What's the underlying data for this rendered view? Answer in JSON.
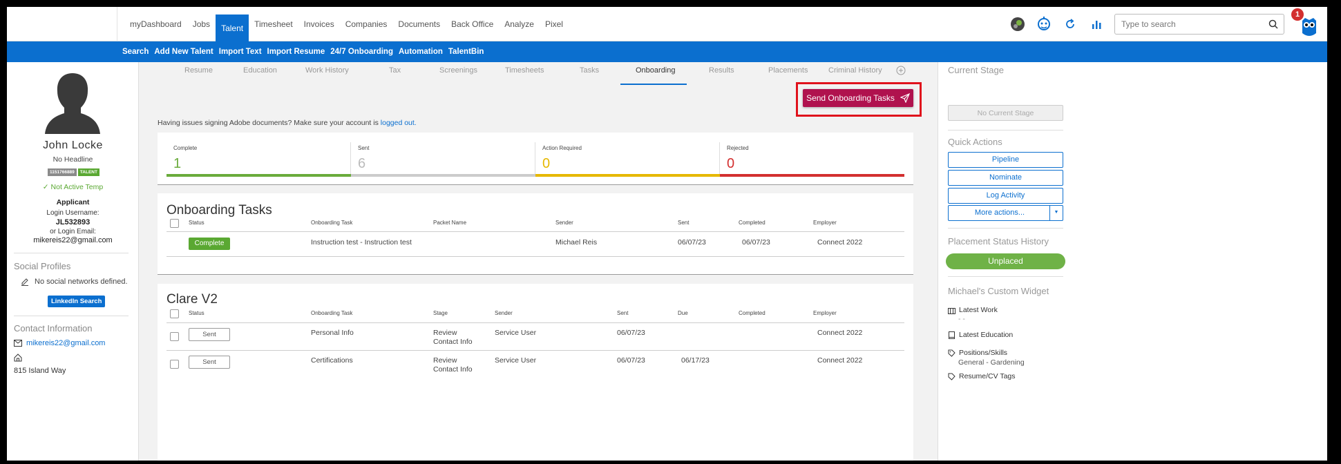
{
  "topnav": {
    "menu": [
      "myDashboard",
      "Jobs",
      "Talent",
      "Timesheet",
      "Invoices",
      "Companies",
      "Documents",
      "Back Office",
      "Analyze",
      "Pixel"
    ],
    "active": "Talent",
    "search_placeholder": "Type to search",
    "notification_count": "1"
  },
  "subnav": {
    "items": [
      "Search",
      "Add New Talent",
      "Import Text",
      "Import Resume",
      "24/7 Onboarding",
      "Automation",
      "TalentBin"
    ]
  },
  "profile": {
    "name": "John Locke",
    "headline": "No Headline",
    "id_tag": "1151766889",
    "type_tag": "TALENT",
    "active_status": "Not Active Temp",
    "role": "Applicant",
    "login_username_label": "Login Username:",
    "login_username": "JL532893",
    "login_email_label": "or Login Email:",
    "login_email": "mikereis22@gmail.com",
    "social_title": "Social Profiles",
    "social_none": "No social networks defined.",
    "linkedin_button": "LinkedIn Search",
    "contact_title": "Contact Information",
    "contact_email": "mikereis22@gmail.com",
    "address": "815 Island Way"
  },
  "tabs": [
    "Resume",
    "Education",
    "Work History",
    "Tax",
    "Screenings",
    "Timesheets",
    "Tasks",
    "Onboarding",
    "Results",
    "Placements",
    "Criminal History"
  ],
  "active_tab": "Onboarding",
  "send_button": "Send Onboarding Tasks",
  "adobe_note": "Having issues signing Adobe documents? Make sure your account is ",
  "adobe_link": "logged out.",
  "stats": [
    {
      "label": "Complete",
      "value": "1",
      "color": "#6aab3c"
    },
    {
      "label": "Sent",
      "value": "6",
      "color": "#cccccc"
    },
    {
      "label": "Action Required",
      "value": "0",
      "color": "#e6b800"
    },
    {
      "label": "Rejected",
      "value": "0",
      "color": "#d32f2f"
    }
  ],
  "onboarding_tasks": {
    "title": "Onboarding Tasks",
    "headers": [
      "Status",
      "Onboarding Task",
      "Packet Name",
      "Sender",
      "Sent",
      "Completed",
      "Employer"
    ],
    "rows": [
      {
        "status": "Complete",
        "task": "Instruction test - Instruction test",
        "packet": "",
        "sender": "Michael Reis",
        "sent": "06/07/23",
        "completed": "06/07/23",
        "employer": "Connect 2022"
      }
    ]
  },
  "clare": {
    "title": "Clare V2",
    "headers": [
      "Status",
      "Onboarding Task",
      "Stage",
      "Sender",
      "Sent",
      "Due",
      "Completed",
      "Employer"
    ],
    "rows": [
      {
        "status": "Sent",
        "task": "Personal Info",
        "stage1": "Review",
        "stage2": "Contact Info",
        "sender": "Service User",
        "sent": "06/07/23",
        "due": "",
        "completed": "",
        "employer": "Connect 2022"
      },
      {
        "status": "Sent",
        "task": "Certifications",
        "stage1": "Review",
        "stage2": "Contact Info",
        "sender": "Service User",
        "sent": "06/07/23",
        "due": "06/17/23",
        "completed": "",
        "employer": "Connect 2022"
      }
    ]
  },
  "right": {
    "current_stage_title": "Current Stage",
    "no_stage": "No Current Stage",
    "quick_actions_title": "Quick Actions",
    "pipeline": "Pipeline",
    "nominate": "Nominate",
    "log_activity": "Log Activity",
    "more_actions": "More actions...",
    "placement_title": "Placement Status History",
    "unplaced": "Unplaced",
    "widget_title": "Michael's Custom Widget",
    "latest_work": "Latest Work",
    "latest_work_value": "- -",
    "latest_education": "Latest Education",
    "positions_skills": "Positions/Skills",
    "positions_value": "General - Gardening",
    "resume_tags": "Resume/CV Tags"
  }
}
